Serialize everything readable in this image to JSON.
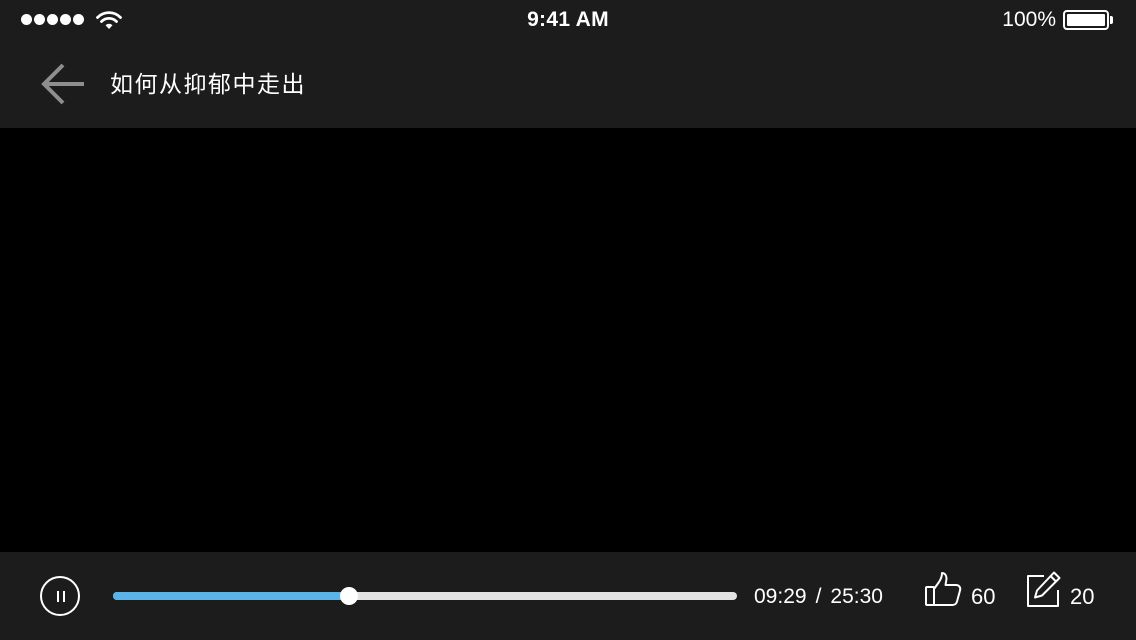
{
  "status_bar": {
    "signal_dots": 5,
    "time": "9:41 AM",
    "battery_percent": "100%",
    "battery_level": 1.0,
    "wifi_icon": "wifi-icon",
    "battery_icon": "battery-icon"
  },
  "nav": {
    "back_icon": "arrow-left-icon",
    "title": "如何从抑郁中走出"
  },
  "player": {
    "state_icon": "pause-icon",
    "current_time": "09:29",
    "separator": "/",
    "total_time": "25:30",
    "progress_fraction": 0.378,
    "likes_icon": "thumbs-up-icon",
    "likes_count": "60",
    "comments_icon": "pencil-edit-icon",
    "comments_count": "20"
  },
  "colors": {
    "bar_background": "#1c1c1c",
    "video_background": "#000000",
    "progress_played": "#5ab4e8",
    "progress_remaining": "#e3e3e3",
    "back_arrow": "#8e8e8e",
    "foreground": "#ffffff"
  }
}
